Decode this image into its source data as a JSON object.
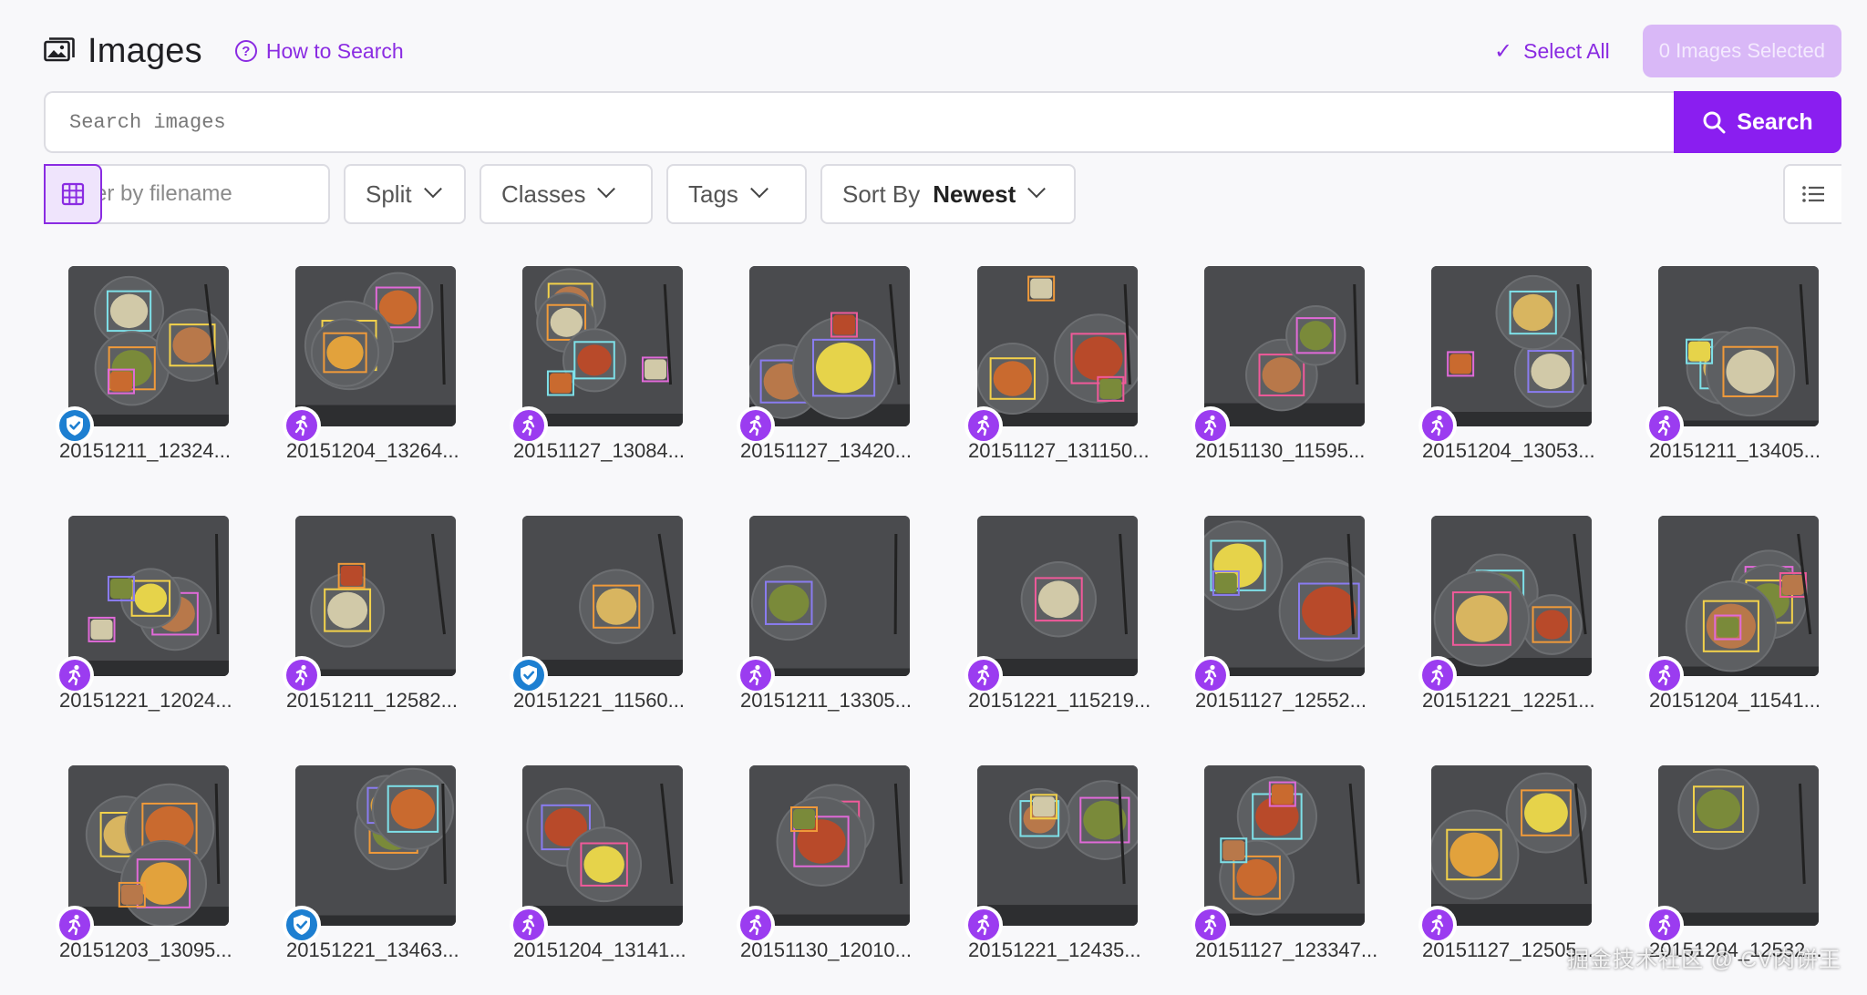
{
  "header": {
    "title": "Images",
    "how_to_search": "How to Search",
    "select_all": "Select All",
    "selected_count": "0 Images Selected"
  },
  "search": {
    "placeholder": "Search images",
    "button_label": "Search"
  },
  "filters": {
    "filename_placeholder": "Filter by filename",
    "split_label": "Split",
    "classes_label": "Classes",
    "tags_label": "Tags",
    "sort_prefix": "Sort By",
    "sort_value": "Newest"
  },
  "view": {
    "active": "grid"
  },
  "colors": {
    "accent": "#8a2be2",
    "badge_run": "#9b3cf0",
    "badge_ok": "#1d7fd1"
  },
  "images": [
    {
      "filename": "20151211_12324...",
      "badge": "verified-icon"
    },
    {
      "filename": "20151204_13264...",
      "badge": "running-icon"
    },
    {
      "filename": "20151127_13084...",
      "badge": "running-icon"
    },
    {
      "filename": "20151127_13420...",
      "badge": "running-icon"
    },
    {
      "filename": "20151127_131150...",
      "badge": "running-icon"
    },
    {
      "filename": "20151130_11595...",
      "badge": "running-icon"
    },
    {
      "filename": "20151204_13053...",
      "badge": "running-icon"
    },
    {
      "filename": "20151211_13405...",
      "badge": "running-icon"
    },
    {
      "filename": "20151221_12024...",
      "badge": "running-icon"
    },
    {
      "filename": "20151211_12582...",
      "badge": "running-icon"
    },
    {
      "filename": "20151221_11560...",
      "badge": "verified-icon"
    },
    {
      "filename": "20151211_13305...",
      "badge": "running-icon"
    },
    {
      "filename": "20151221_115219...",
      "badge": "running-icon"
    },
    {
      "filename": "20151127_12552...",
      "badge": "running-icon"
    },
    {
      "filename": "20151221_12251...",
      "badge": "running-icon"
    },
    {
      "filename": "20151204_11541...",
      "badge": "running-icon"
    },
    {
      "filename": "20151203_13095...",
      "badge": "running-icon"
    },
    {
      "filename": "20151221_13463...",
      "badge": "verified-icon"
    },
    {
      "filename": "20151204_13141...",
      "badge": "running-icon"
    },
    {
      "filename": "20151130_12010...",
      "badge": "running-icon"
    },
    {
      "filename": "20151221_12435...",
      "badge": "running-icon"
    },
    {
      "filename": "20151127_123347...",
      "badge": "running-icon"
    },
    {
      "filename": "20151127_12505...",
      "badge": "running-icon"
    },
    {
      "filename": "20151204_12532...",
      "badge": "running-icon"
    }
  ],
  "watermark": "掘金技术社区 @ CV肉饼王"
}
